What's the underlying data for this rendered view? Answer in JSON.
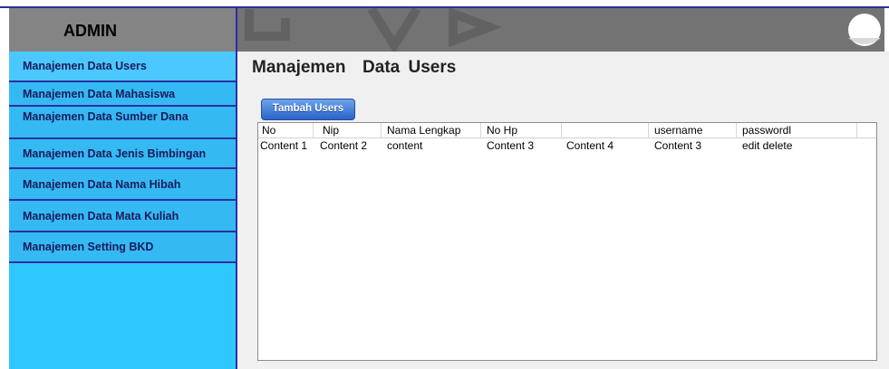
{
  "header": {
    "title": "ADMIN"
  },
  "sidebar": {
    "items": [
      {
        "label": "Manajemen Data Users"
      },
      {
        "label": "Manajemen Data Mahasiswa"
      },
      {
        "label": "Manajemen Data Sumber Dana"
      },
      {
        "label": "Manajemen Data Jenis Bimbingan"
      },
      {
        "label": "Manajemen Data Nama Hibah"
      },
      {
        "label": "Manajemen Data Mata Kuliah"
      },
      {
        "label": "Manajemen Setting BKD"
      }
    ]
  },
  "main": {
    "title": "Manajemen  Data Users",
    "add_button": "Tambah Users",
    "table": {
      "columns": [
        "No",
        "Nip",
        "Nama Lengkap",
        "No Hp",
        "",
        "username",
        "passwordl"
      ],
      "rows": [
        [
          "Content 1",
          "Content 2",
          "content",
          "Content 3",
          "Content 4",
          "Content 3",
          "edit delete"
        ]
      ]
    }
  },
  "colors": {
    "header_bg": "#737373",
    "sidebar_bg": "#35b9f3",
    "border": "#2b2fa0",
    "button": "#2a63c9"
  }
}
